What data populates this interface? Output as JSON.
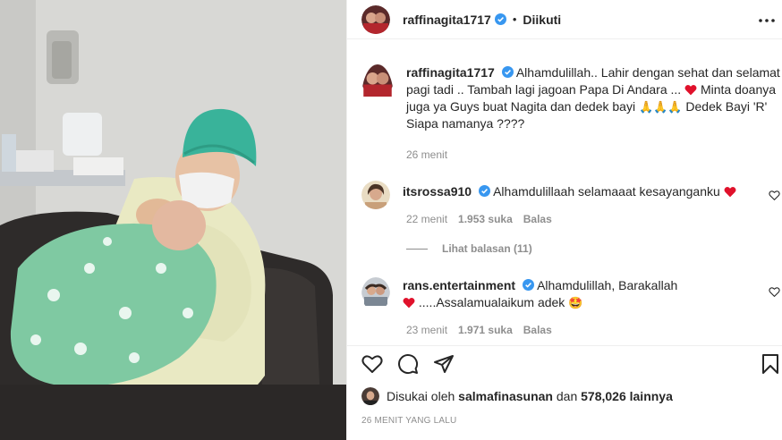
{
  "post": {
    "username": "raffinagita1717",
    "dot": "•",
    "follow_status": "Diikuti"
  },
  "caption": {
    "username": "raffinagita1717",
    "text_part1": "Alhamdulillah.. Lahir dengan sehat dan selamat pagi tadi .. Tambah lagi jagoan Papa Di Andara ...",
    "text_part2": "Minta doanya juga ya Guys buat Nagita dan dedek bayi",
    "emoji_pray": "🙏🙏🙏",
    "text_part3": "Dedek Bayi 'R' Siapa namanya ????",
    "time": "26 menit"
  },
  "comments": [
    {
      "username": "itsrossa910",
      "text": "Alhamdulillaah selamaaat kesayanganku",
      "time": "22 menit",
      "likes": "1.953 suka",
      "reply_label": "Balas",
      "view_replies": "Lihat balasan (11)"
    },
    {
      "username": "rans.entertainment",
      "text_part1": "Alhamdulillah, Barakallah",
      "text_part2": ".....Assalamualaikum adek",
      "emoji": "🤩",
      "time": "23 menit",
      "likes": "1.971 suka",
      "reply_label": "Balas"
    }
  ],
  "liked_by": {
    "prefix": "Disukai oleh",
    "username": "salmafinasunan",
    "middle": "dan",
    "count": "578,026",
    "suffix": "lainnya"
  },
  "posted_ago": "26 MENIT YANG LALU",
  "icons": {
    "verified": "verified-badge-icon",
    "more": "more-options-icon",
    "like": "heart-icon",
    "comment": "comment-bubble-icon",
    "share": "paper-plane-icon",
    "save": "bookmark-icon"
  },
  "colors": {
    "verified": "#3897f0",
    "heart_red": "#ed4956",
    "muted_text": "#8e8e8e",
    "text": "#262626"
  }
}
